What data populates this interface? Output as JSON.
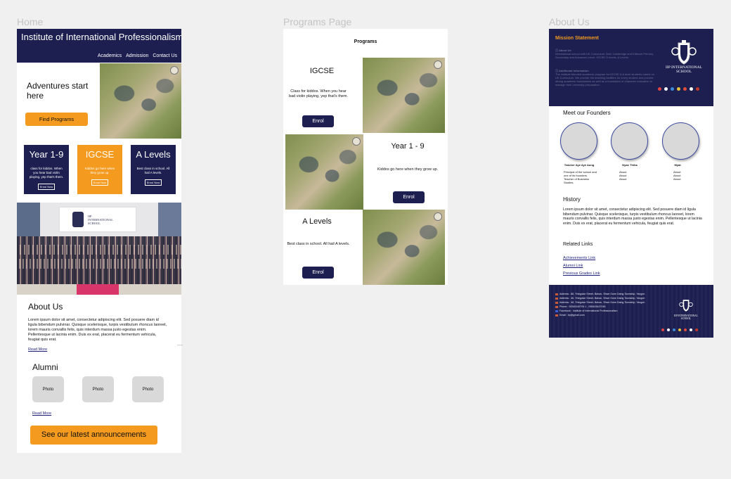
{
  "labels": {
    "home": "Home",
    "programs": "Programs Page",
    "about": "About Us"
  },
  "home": {
    "title": "Institute of International Professionalism",
    "nav": [
      "Academics",
      "Admission",
      "Contact Us"
    ],
    "hero": "Adventures start here",
    "find_programs": "Find Programs",
    "cards": [
      {
        "title": "Year 1-9",
        "desc": "class for kiddos. When you hear bad violin playing, yep that's them.",
        "btn": "Enrol Now",
        "color": "#1c1f4f"
      },
      {
        "title": "IGCSE",
        "desc": "Kiddos go here when they grow up.",
        "btn": "Enrol Now",
        "color": "#f39a1f"
      },
      {
        "title": "A Levels",
        "desc": "Best class in school. All hail A levels.",
        "btn": "Enrol Now",
        "color": "#1c1f4f"
      }
    ],
    "banner_school": "IIP INTERNATIONAL SCHOOL",
    "about_title": "About Us",
    "about_body": "Lorem ipsum dolor sit amet, consectetur adipiscing elit. Sed posuere diam id ligula bibendum pulvinar. Quisque scelerisque, turpis vestibulum rhoncus laoreet, lorem mauris convallis felis, quis interdum massa justo egestas enim. Pellentesque ut lacinia enim. Duis ex erat, placerat eu fermentum vehicula, feugiat quis erat.",
    "read_more": "Read More",
    "alumni_title": "Alumni",
    "alumni_photos": [
      "Photo",
      "Photo",
      "Photo"
    ],
    "alumni_read_more": "Read More",
    "announcements": "See our latest announcements"
  },
  "programs": {
    "title": "Programs",
    "items": [
      {
        "title": "IGCSE",
        "desc": "Class for kiddos. When you hear bad violin playing, yep that's them.",
        "btn": "Enrol"
      },
      {
        "title": "Year 1 - 9",
        "desc": "Kiddos go here when they grow up.",
        "btn": "Enrol"
      },
      {
        "title": "A Levels",
        "desc": "Best class in school. All hail A levels.",
        "btn": "Enrol"
      }
    ]
  },
  "about": {
    "mission_title": "Mission Statement",
    "mission_items": [
      {
        "head": "About Us",
        "body": "International school with UK Curriculum. Both Cambridge and Edexcel Primary, Secondary and Advanced Level. IGCSE O levels, A Levels."
      },
      {
        "head": "Additional Information",
        "body": "The institute blended academic program for IGCSE & A level students based on UK Curriculum. We provide the teaching facilities for every student and provide strong academic foundations as well as a foundation of character education to manage their university preparation."
      }
    ],
    "crest_name": "IIP INTERNATIONAL SCHOOL",
    "founders_title": "Meet our Founders",
    "founders": [
      {
        "name": "Teacher Aye Aye Aung",
        "desc": "Principal of the school and one of its founders. Teacher of Business Studies."
      },
      {
        "name": "Nyan Thiha",
        "desc": "About About About"
      },
      {
        "name": "Myat",
        "desc": "About About About"
      }
    ],
    "history_title": "History",
    "history_body": "Lorem ipsum dolor sit amet, consectetur adipiscing elit. Sed posuere diam id ligula bibendum pulvinar. Quisque scelerisque, turpis vestibulum rhoncus laoreet, lorem mauris convallis felis, quis interdum massa justo egestas enim. Pellentesque ut lacinia enim. Duis ex erat, placerat eu fermentum vehicula, feugiat quis erat.",
    "links_title": "Related Links",
    "links": [
      "Achievements Link",
      "Alumni Link",
      "Previous Grades Link"
    ],
    "footer": [
      "Address : 88, Yhingdae Street, Bahan, Shwe Gone Daing Township, Yangon",
      "Address : 46, Yhingdae Street, Bahan, Shwe Gone Daing Township, Yangon",
      "Address : 48, Yhingdae Street, Bahan, Shwe Gone Daing Township, Yangon",
      "Phone : 09345145794 1 , 095403447045",
      "Facebook : Institute of International Professionalism",
      "Email : iip@gmail.com"
    ],
    "footer_crest": "IIP INTERNATIONAL SCHOOL"
  }
}
